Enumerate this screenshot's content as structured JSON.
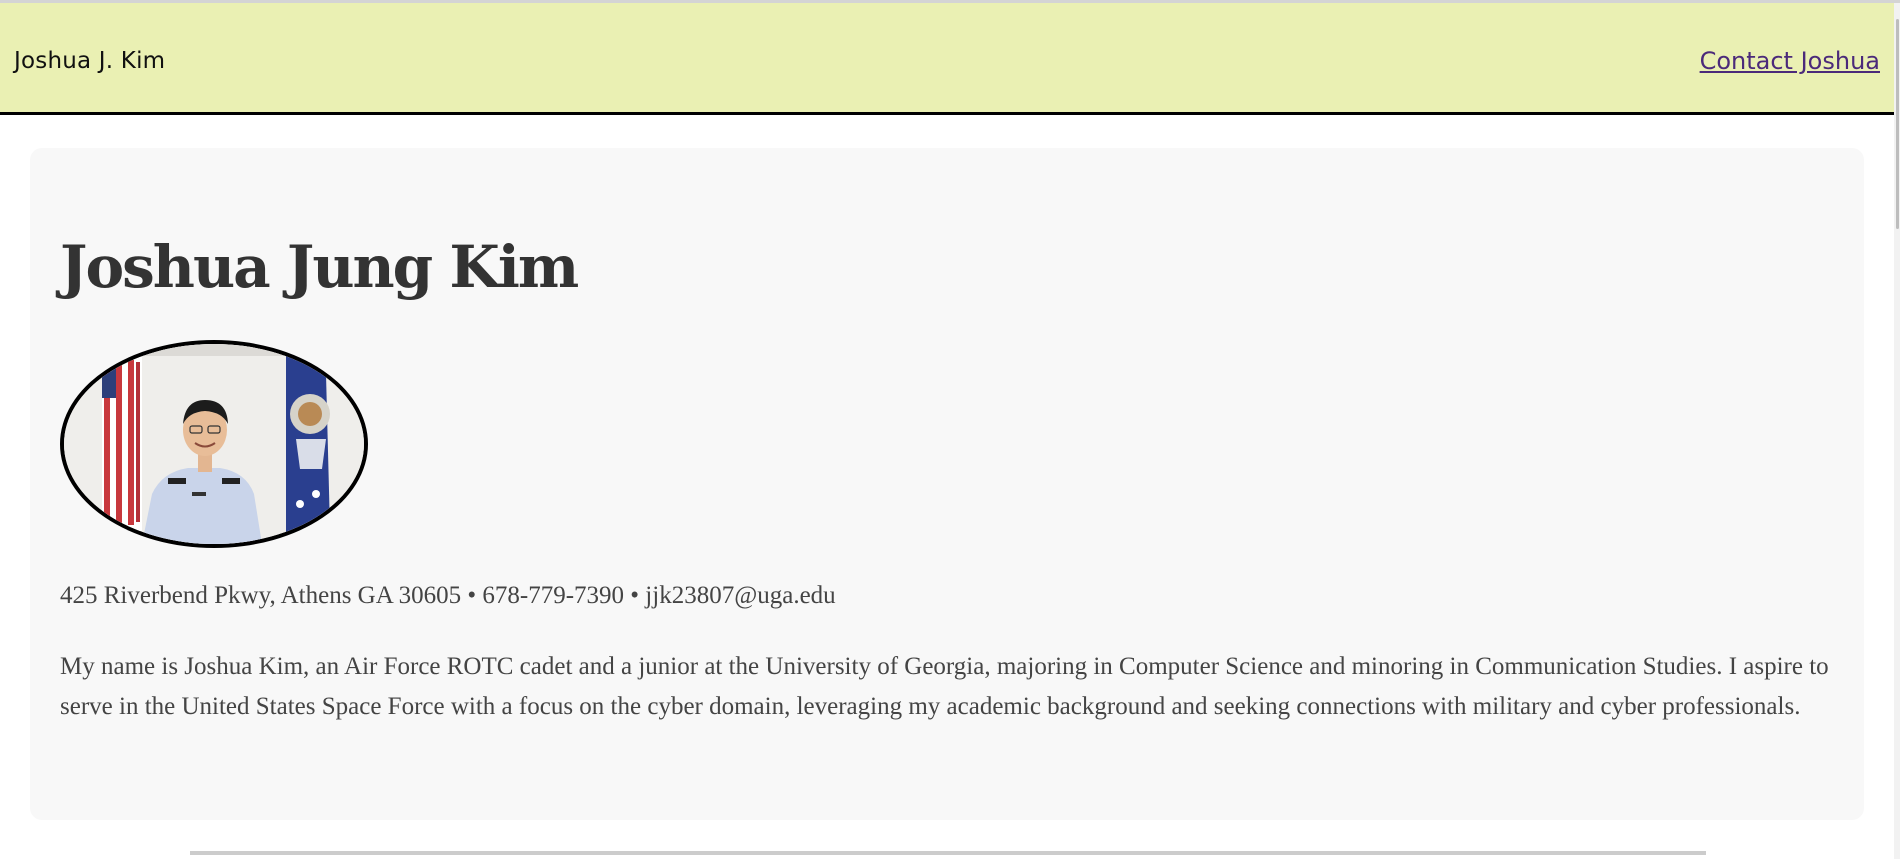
{
  "navbar": {
    "brand": "Joshua J. Kim",
    "contact_link": "Contact Joshua",
    "background_color": "#eaf0b3",
    "link_color": "#4b2a7a"
  },
  "profile": {
    "name": "Joshua Jung Kim",
    "photo": "profile-photo",
    "contact_line": "425 Riverbend Pkwy, Athens GA 30605 • 678-779-7390 • jjk23807@uga.edu",
    "bio": "My name is Joshua Kim, an Air Force ROTC cadet and a junior at the University of Georgia, majoring in Computer Science and minoring in Communication Studies. I aspire to serve in the United States Space Force with a focus on the cyber domain, leveraging my academic background and seeking connections with military and cyber professionals."
  }
}
